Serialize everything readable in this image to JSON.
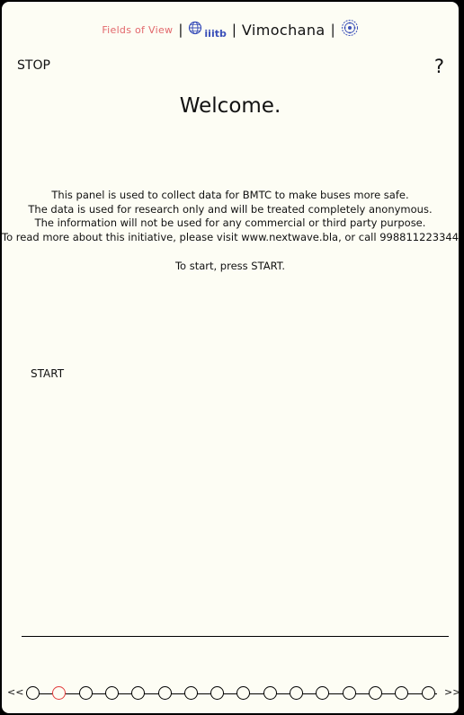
{
  "header": {
    "fields_of_view": "Fields of View",
    "separator": "|",
    "iiitb_logo_text": "iiitb",
    "vimochana": "Vimochana",
    "iiitb_logo_icon": "globe-icon",
    "vimochana_logo_icon": "vimochana-seal-icon"
  },
  "controls": {
    "stop_label": "STOP",
    "help_label": "?",
    "start_label": "START"
  },
  "main": {
    "title": "Welcome.",
    "info_lines": [
      "This panel is used to collect data for BMTC to make buses more safe.",
      "The data is used for research only and will be treated completely anonymous.",
      "The information will not be used for any commercial or third party purpose.",
      "To read more about this initiative, please visit www.nextwave.bla, or call 998811223344."
    ],
    "instruction": "To start, press START."
  },
  "pager": {
    "prev_label": "<<",
    "next_label": ">>",
    "total_steps": 16,
    "current_step": 2,
    "active_color": "#e23b3b"
  }
}
